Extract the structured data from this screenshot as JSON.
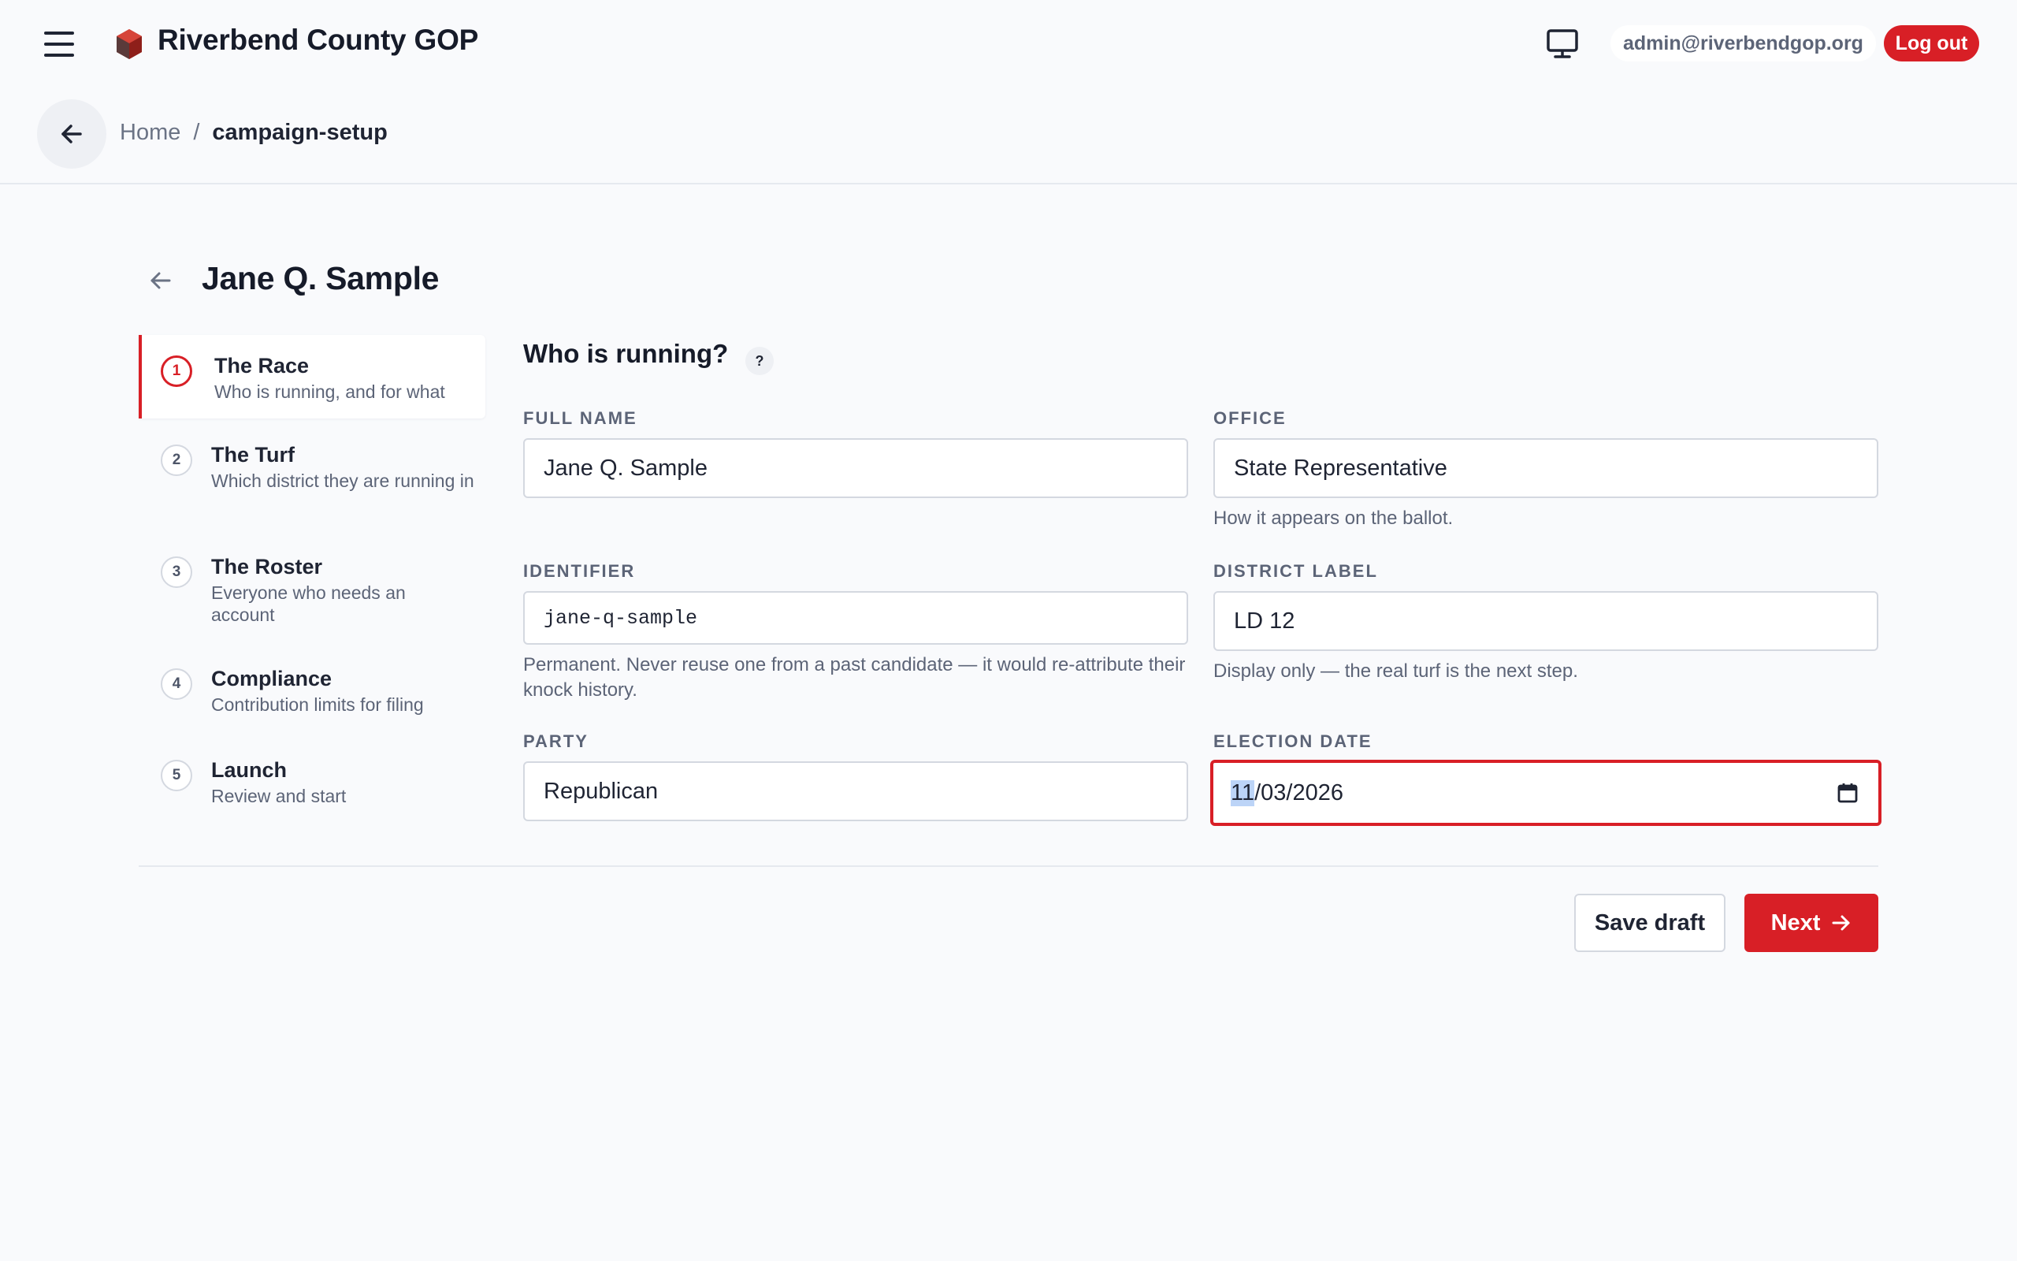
{
  "app": {
    "title": "Riverbend County GOP",
    "user_email": "admin@riverbendgop.org",
    "logout_label": "Log out",
    "brand_color": "#d81f26"
  },
  "breadcrumb": {
    "home": "Home",
    "separator": "/",
    "current": "campaign-setup"
  },
  "page": {
    "title": "Jane Q. Sample"
  },
  "steps": [
    {
      "number": "1",
      "title": "The Race",
      "desc": "Who is running, and for what",
      "active": true
    },
    {
      "number": "2",
      "title": "The Turf",
      "desc": "Which district they are running in",
      "active": false
    },
    {
      "number": "3",
      "title": "The Roster",
      "desc": "Everyone who needs an account",
      "active": false
    },
    {
      "number": "4",
      "title": "Compliance",
      "desc": "Contribution limits for filing",
      "active": false
    },
    {
      "number": "5",
      "title": "Launch",
      "desc": "Review and start",
      "active": false
    }
  ],
  "form": {
    "section_title": "Who is running?",
    "help_label": "?",
    "full_name": {
      "label": "FULL NAME",
      "value": "Jane Q. Sample"
    },
    "office": {
      "label": "OFFICE",
      "value": "State Representative",
      "hint": "How it appears on the ballot."
    },
    "identifier": {
      "label": "IDENTIFIER",
      "value": "jane-q-sample",
      "hint": "Permanent. Never reuse one from a past candidate — it would re-attribute their knock history."
    },
    "district_label": {
      "label": "DISTRICT LABEL",
      "value": "LD 12",
      "hint": "Display only — the real turf is the next step."
    },
    "party": {
      "label": "PARTY",
      "value": "Republican"
    },
    "election_date": {
      "label": "ELECTION DATE",
      "month": "11",
      "rest": "/03/2026"
    }
  },
  "actions": {
    "save_draft": "Save draft",
    "next": "Next"
  },
  "icons": {
    "menu": "hamburger-menu-icon",
    "logo": "hexagon-logo-icon",
    "monitor": "monitor-icon",
    "back": "arrow-left-icon",
    "calendar": "calendar-icon",
    "next": "arrow-right-icon"
  }
}
